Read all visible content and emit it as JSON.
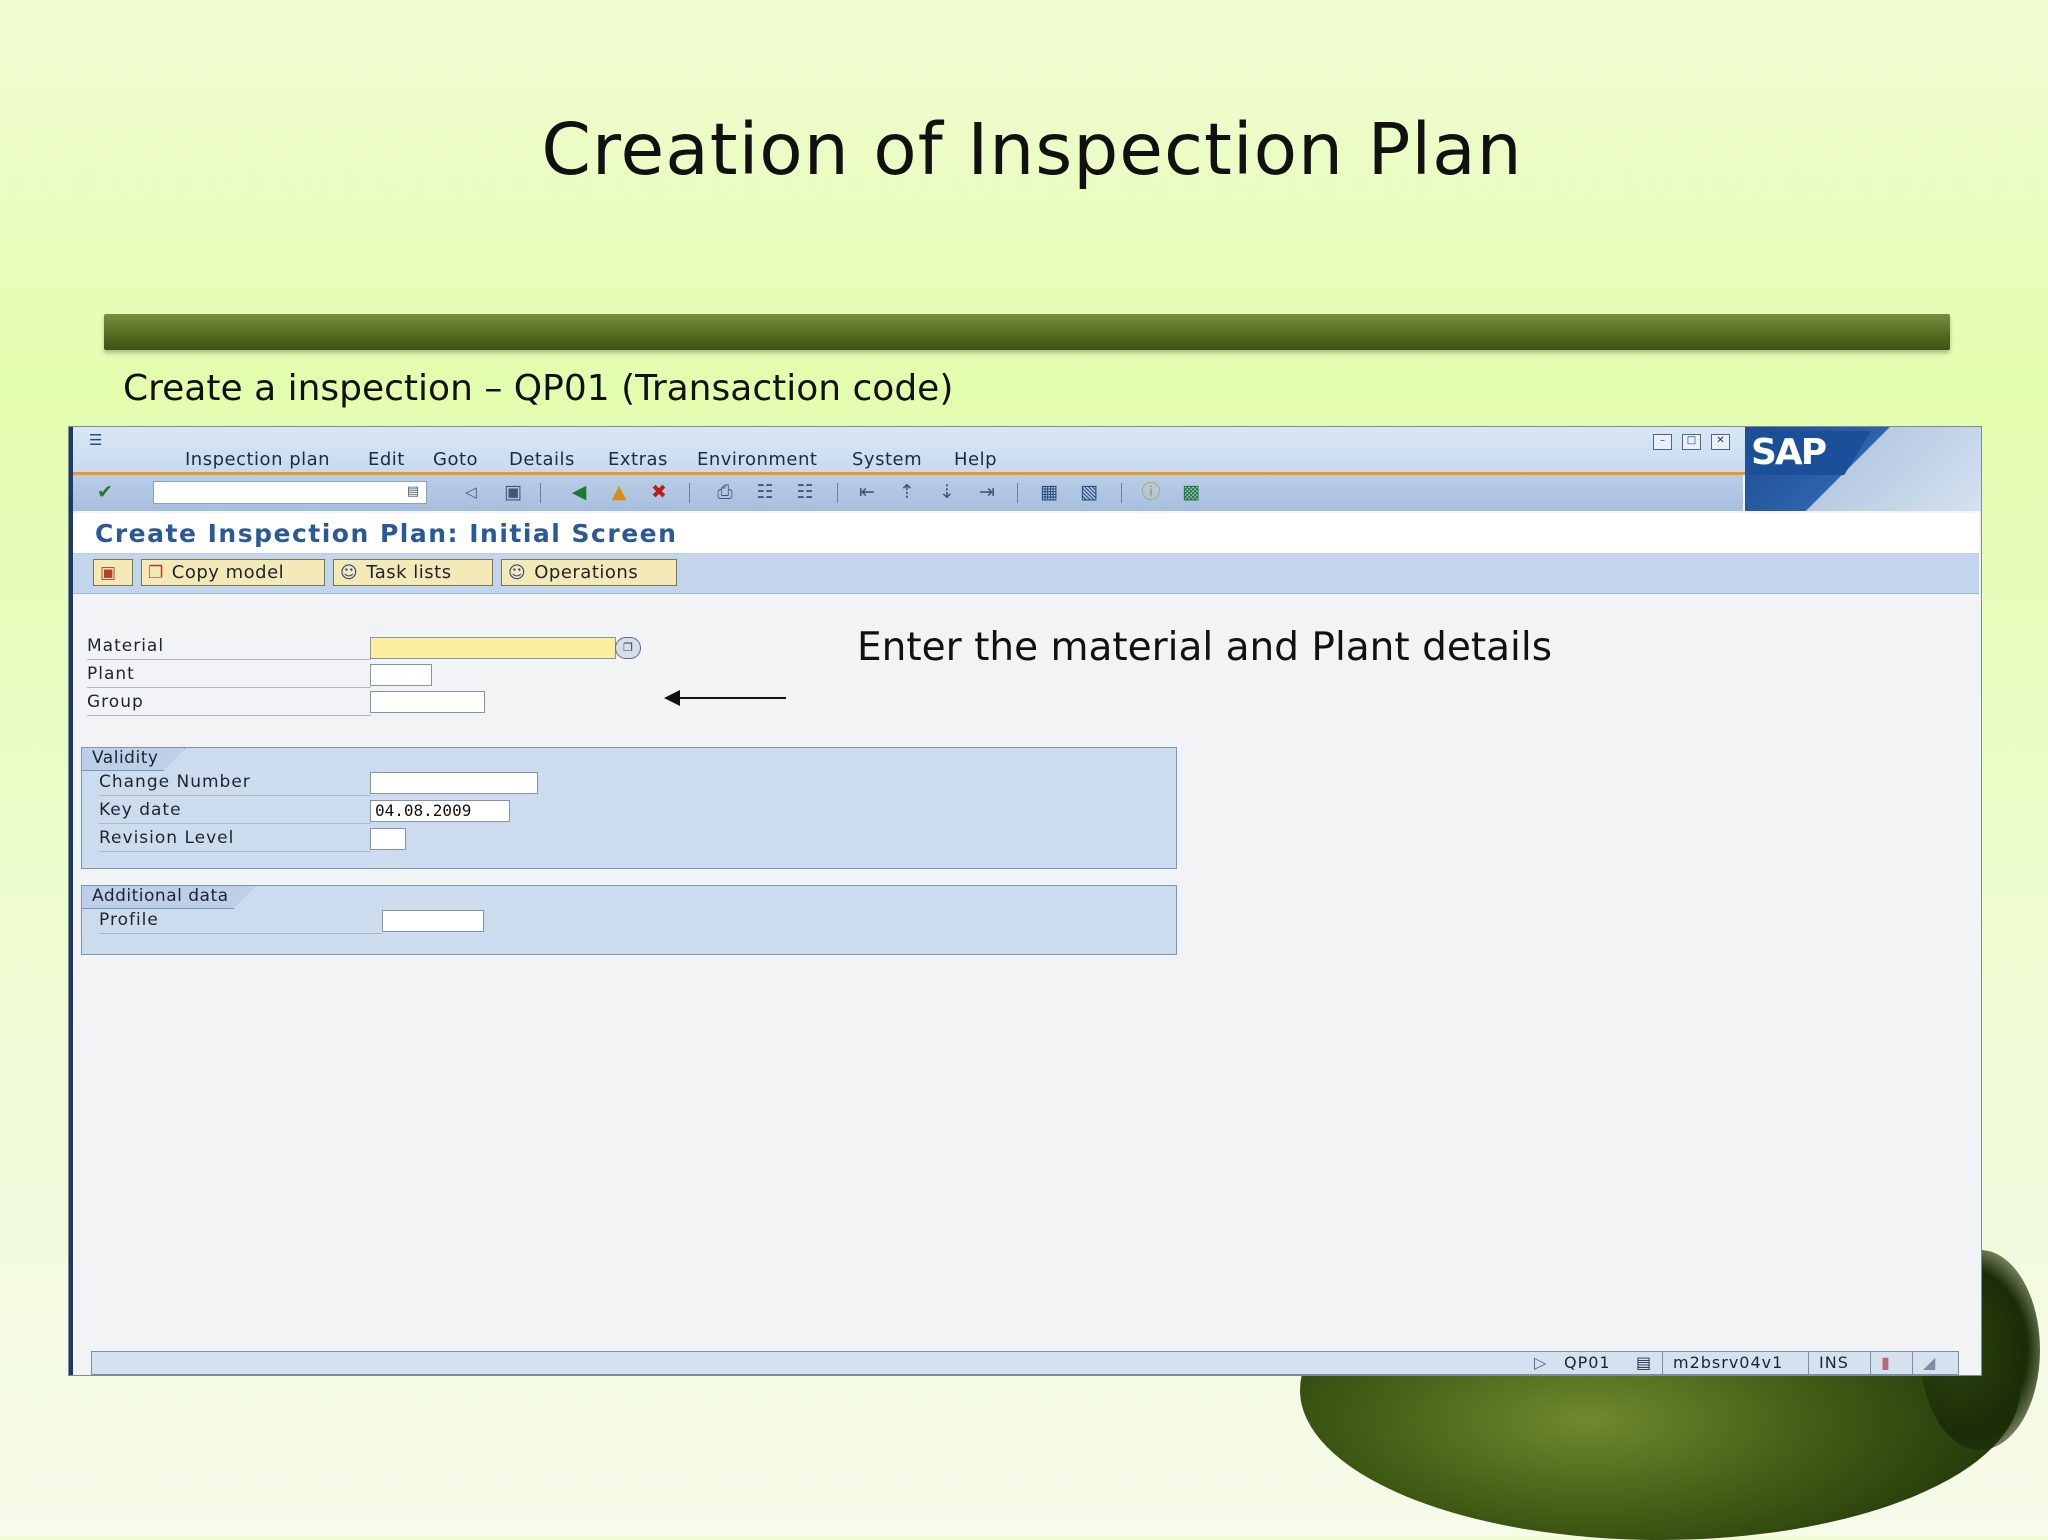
{
  "slide": {
    "title": "Creation of Inspection Plan",
    "subtitle": "Create a inspection – QP01 (Transaction code)",
    "annotation": "Enter the material and Plant details"
  },
  "sap": {
    "menu": [
      "Inspection plan",
      "Edit",
      "Goto",
      "Details",
      "Extras",
      "Environment",
      "System",
      "Help"
    ],
    "logo": "SAP",
    "command_field_value": "",
    "screen_title": "Create Inspection Plan: Initial Screen",
    "app_toolbar": {
      "copy_model": "Copy model",
      "task_lists": "Task lists",
      "operations": "Operations"
    },
    "fields": {
      "material": {
        "label": "Material",
        "value": ""
      },
      "plant": {
        "label": "Plant",
        "value": ""
      },
      "group": {
        "label": "Group",
        "value": ""
      }
    },
    "validity": {
      "title": "Validity",
      "change_number": {
        "label": "Change Number",
        "value": ""
      },
      "key_date": {
        "label": "Key date",
        "value": "04.08.2009"
      },
      "revision_level": {
        "label": "Revision Level",
        "value": ""
      }
    },
    "additional": {
      "title": "Additional data",
      "profile": {
        "label": "Profile",
        "value": ""
      }
    },
    "status_bar": {
      "transaction": "QP01",
      "server": "m2bsrv04v1",
      "mode": "INS"
    }
  },
  "colors": {
    "sap_title": "#2b5897",
    "required_field": "#fbee9f",
    "menu_underline": "#e59a2c"
  }
}
